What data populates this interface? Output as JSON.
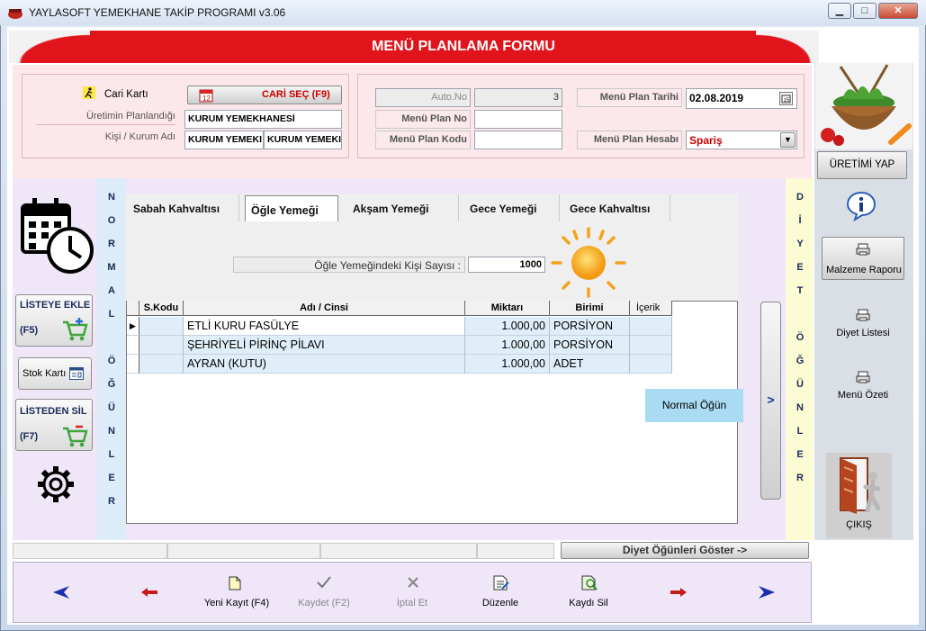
{
  "window": {
    "title": "YAYLASOFT YEMEKHANE TAKİP PROGRAMI v3.06",
    "min": "▁",
    "max": "□",
    "close": "✕"
  },
  "form_title": "MENÜ PLANLAMA FORMU",
  "cari": {
    "label": "Cari Kartı",
    "button": "CARİ SEÇ (F9)",
    "planned_for_label": "Üretimin Planlandığı",
    "planned_for_value": "KURUM YEMEKHANESİ",
    "person_label": "Kişi / Kurum Adı",
    "person_value1": "KURUM YEMEKI",
    "person_value2": "KURUM YEMEKI"
  },
  "plan": {
    "auto_no_label": "Auto.No",
    "auto_no_value": "3",
    "plan_no_label": "Menü Plan No",
    "plan_no_value": "",
    "plan_code_label": "Menü Plan Kodu",
    "plan_code_value": "",
    "date_label": "Menü Plan Tarihi",
    "date_value": "02.08.2019",
    "account_label": "Menü Plan Hesabı",
    "account_value": "Spariş"
  },
  "tabs": [
    {
      "label": "Sabah Kahvaltısı"
    },
    {
      "label": "Öğle Yemeği"
    },
    {
      "label": "Akşam Yemeği"
    },
    {
      "label": "Gece Yemeği"
    },
    {
      "label": "Gece Kahvaltısı"
    }
  ],
  "count": {
    "label": "Öğle Yemeğindeki Kişi Sayısı :",
    "value": "1000"
  },
  "table": {
    "headers": [
      "S.Kodu",
      "Adı / Cinsi",
      "Miktarı",
      "Birimi",
      "İçerik"
    ],
    "rows": [
      {
        "code": "",
        "name": "ETLİ KURU FASÜLYE",
        "qty": "1.000,00",
        "unit": "PORSİYON",
        "content": ""
      },
      {
        "code": "",
        "name": "ŞEHRİYELİ PİRİNÇ PİLAVI",
        "qty": "1.000,00",
        "unit": "PORSİYON",
        "content": ""
      },
      {
        "code": "",
        "name": "AYRAN (KUTU)",
        "qty": "1.000,00",
        "unit": "ADET",
        "content": ""
      }
    ]
  },
  "normal_ogun_btn": "Normal Öğün",
  "left": {
    "add_label": "LİSTEYE EKLE",
    "add_key": "(F5)",
    "stock_label": "Stok Kartı",
    "remove_label": "LİSTEDEN SİL",
    "remove_key": "(F7)",
    "normal_letters": [
      "N",
      "O",
      "R",
      "M",
      "A",
      "L",
      "",
      "Ö",
      "Ğ",
      "Ü",
      "N",
      "L",
      "E",
      "R"
    ]
  },
  "diyet_letters": [
    "D",
    "İ",
    "Y",
    "E",
    "T",
    "",
    "Ö",
    "Ğ",
    "Ü",
    "N",
    "L",
    "E",
    "R"
  ],
  "expand_arrow": ">",
  "diyet_show_btn": "Diyet Öğünleri Göster ->",
  "right": {
    "uretim_btn": "ÜRETİMİ YAP",
    "malzeme_btn": "Malzeme Raporu",
    "diyet_list": "Diyet Listesi",
    "menu_ozet": "Menü Özeti",
    "exit": "ÇIKIŞ"
  },
  "bottom": {
    "new": "Yeni Kayıt (F4)",
    "save": "Kaydet (F2)",
    "cancel": "İptal Et",
    "edit": "Düzenle",
    "delete": "Kaydı Sil"
  },
  "colors": {
    "banner": "#e1141b",
    "account_text": "#cc0000",
    "row_highlight": "#dfeef8"
  }
}
